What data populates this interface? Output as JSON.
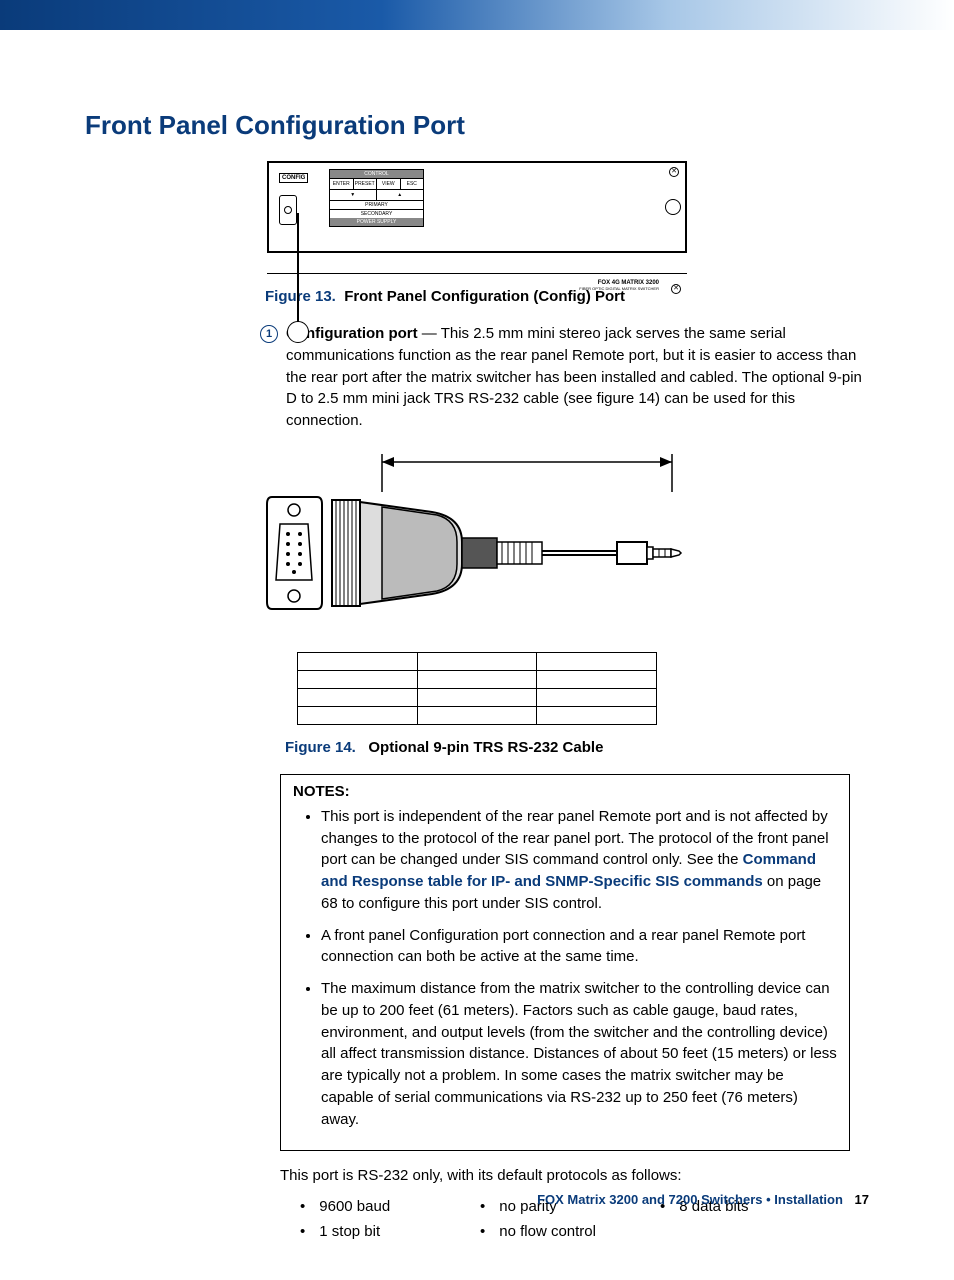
{
  "heading": "Front Panel Configuration Port",
  "panel": {
    "config_label": "CONFIG",
    "control_header": "CONTROL",
    "buttons": [
      "ENTER",
      "PRESET",
      "VIEW",
      "ESC"
    ],
    "arrows": [
      "▼",
      "▲"
    ],
    "primary": "PRIMARY",
    "secondary": "SECONDARY",
    "power_supply": "POWER SUPPLY",
    "product": "FOX 4G MATRIX 3200",
    "product_sub": "FIBER OPTIC DIGITAL MATRIX SWITCHER"
  },
  "fig13": {
    "num": "Figure 13.",
    "title": "Front Panel Configuration (Config) Port"
  },
  "callout": {
    "n": "1",
    "label": "Configuration port",
    "text": " — This 2.5 mm mini stereo jack serves the same serial communications function as the rear panel Remote port, but it is easier to access than the rear port after the matrix switcher has been installed and cabled. The optional 9-pin D to 2.5 mm mini jack TRS RS-232 cable (see figure 14) can be used for this connection."
  },
  "fig14": {
    "num": "Figure 14.",
    "title": "Optional 9-pin TRS RS-232 Cable"
  },
  "notes": {
    "header": "NOTES:",
    "items": [
      {
        "pre": "This port is independent of the rear panel Remote port and is not affected by changes to the protocol of the rear panel port. The protocol of the front panel port can be changed under SIS command control only. See the ",
        "link": "Command and Response table for IP- and SNMP-Specific SIS commands",
        "post": " on page 68 to configure this port under SIS control."
      },
      {
        "pre": "A front panel Configuration port connection and a rear panel Remote port connection can both be active at the same time.",
        "link": "",
        "post": ""
      },
      {
        "pre": "The maximum distance from the matrix switcher to the controlling device can be up to 200 feet (61 meters). Factors such as cable gauge, baud rates, environment, and output levels (from the switcher and the controlling device) all affect transmission distance. Distances of about 50 feet (15 meters) or less are typically not a problem. In some cases the matrix switcher may be capable of serial communications via RS-232 up to 250 feet (76 meters) away.",
        "link": "",
        "post": ""
      }
    ]
  },
  "proto_intro": "This port is RS-232 only, with its default protocols as follows:",
  "protocols": [
    "9600 baud",
    "no parity",
    "8 data bits",
    "1 stop bit",
    "no flow control"
  ],
  "footer": {
    "title": "FOX Matrix 3200 and 7200 Switchers • Installation",
    "page": "17"
  }
}
